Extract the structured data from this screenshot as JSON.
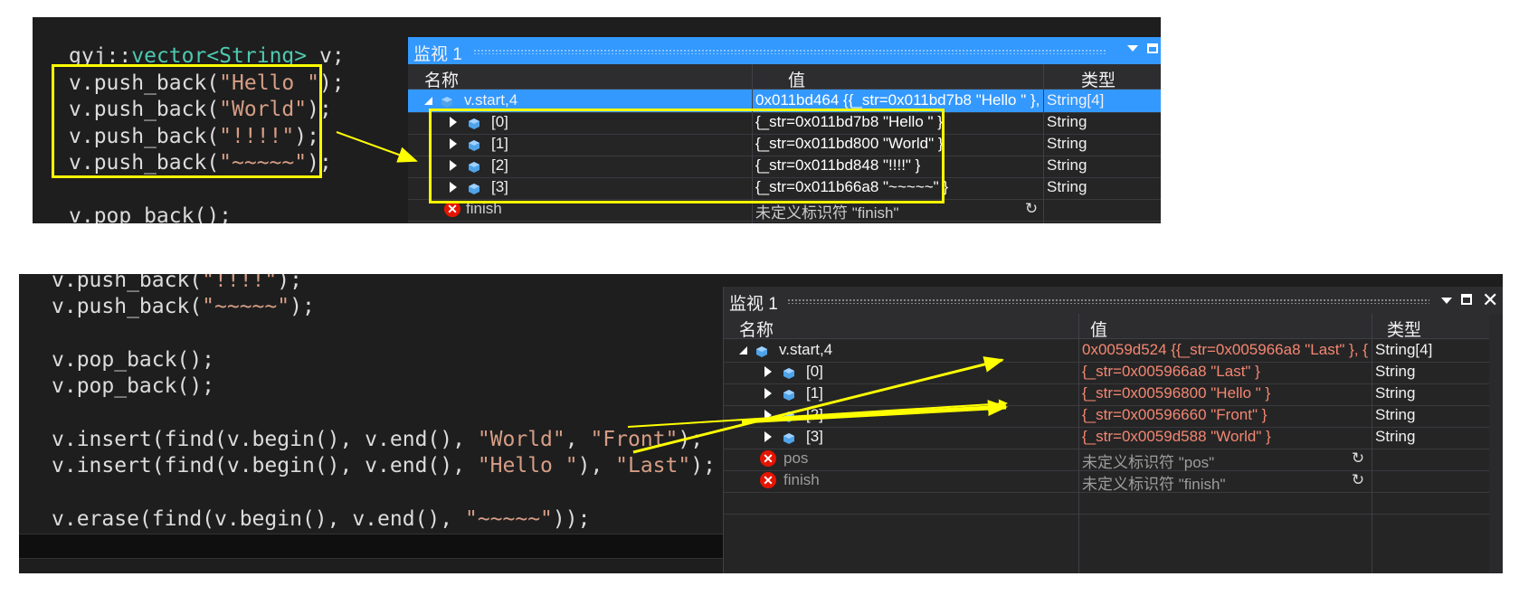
{
  "top": {
    "code_lines": [
      {
        "parts": [
          [
            "gyj::",
            "ns"
          ],
          [
            "vector<String>",
            "type"
          ],
          [
            " v;",
            "id"
          ]
        ]
      },
      {
        "parts": [
          [
            "v.push_back(",
            "id"
          ],
          [
            "\"Hello \"",
            "str"
          ],
          [
            ");",
            "id"
          ]
        ]
      },
      {
        "parts": [
          [
            "v.push_back(",
            "id"
          ],
          [
            "\"World\"",
            "str"
          ],
          [
            ");",
            "id"
          ]
        ]
      },
      {
        "parts": [
          [
            "v.push_back(",
            "id"
          ],
          [
            "\"!!!!\"",
            "str"
          ],
          [
            ");",
            "id"
          ]
        ]
      },
      {
        "parts": [
          [
            "v.push_back(",
            "id"
          ],
          [
            "\"~~~~~\"",
            "str"
          ],
          [
            ");",
            "id"
          ]
        ]
      },
      {
        "parts": [
          [
            "",
            "id"
          ]
        ]
      },
      {
        "parts": [
          [
            "v.pop_back();",
            "id"
          ]
        ]
      }
    ],
    "watch": {
      "title": "监视 1",
      "headers": {
        "name": "名称",
        "value": "值",
        "type": "类型"
      },
      "root": {
        "name": "v.start,4",
        "value": "0x011bd464 {{_str=0x011bd7b8 \"Hello \" },",
        "type": "String[4]"
      },
      "items": [
        {
          "name": "[0]",
          "value": "{_str=0x011bd7b8 \"Hello \" }",
          "type": "String"
        },
        {
          "name": "[1]",
          "value": "{_str=0x011bd800 \"World\" }",
          "type": "String"
        },
        {
          "name": "[2]",
          "value": "{_str=0x011bd848 \"!!!!\" }",
          "type": "String"
        },
        {
          "name": "[3]",
          "value": "{_str=0x011b66a8 \"~~~~~\" }",
          "type": "String"
        }
      ],
      "partial_row": {
        "name": "finish",
        "value": "未定义标识符 \"finish\""
      }
    }
  },
  "bottom": {
    "code_lines": [
      {
        "parts": [
          [
            "v.push_back(",
            "id"
          ],
          [
            "\"!!!!\"",
            "str"
          ],
          [
            ");",
            "id"
          ]
        ]
      },
      {
        "parts": [
          [
            "v.push_back(",
            "id"
          ],
          [
            "\"~~~~~\"",
            "str"
          ],
          [
            ");",
            "id"
          ]
        ]
      },
      {
        "parts": [
          [
            "",
            "id"
          ]
        ]
      },
      {
        "parts": [
          [
            "v.pop_back();",
            "id"
          ]
        ]
      },
      {
        "parts": [
          [
            "v.pop_back();",
            "id"
          ]
        ]
      },
      {
        "parts": [
          [
            "",
            "id"
          ]
        ]
      },
      {
        "parts": [
          [
            "v.insert(find(v.begin(), v.end(), ",
            "id"
          ],
          [
            "\"World\"",
            "str"
          ],
          [
            ", ",
            "id"
          ],
          [
            "\"Front\"",
            "str"
          ],
          [
            ");",
            "id"
          ]
        ]
      },
      {
        "parts": [
          [
            "v.insert(find(v.begin(), v.end(), ",
            "id"
          ],
          [
            "\"Hello \"",
            "str"
          ],
          [
            "), ",
            "id"
          ],
          [
            "\"Last\"",
            "str"
          ],
          [
            ");",
            "id"
          ]
        ]
      },
      {
        "parts": [
          [
            "",
            "id"
          ]
        ]
      },
      {
        "parts": [
          [
            "v.erase(find(v.begin(), v.end(), ",
            "id"
          ],
          [
            "\"~~~~~\"",
            "str"
          ],
          [
            "));",
            "id"
          ]
        ]
      }
    ],
    "watch": {
      "title": "监视 1",
      "headers": {
        "name": "名称",
        "value": "值",
        "type": "类型"
      },
      "root": {
        "name": "v.start,4",
        "value": "0x0059d524 {{_str=0x005966a8 \"Last\" }, {_s",
        "type": "String[4]"
      },
      "items": [
        {
          "name": "[0]",
          "value": "{_str=0x005966a8 \"Last\" }",
          "type": "String"
        },
        {
          "name": "[1]",
          "value": "{_str=0x00596800 \"Hello \" }",
          "type": "String"
        },
        {
          "name": "[2]",
          "value": "{_str=0x00596660 \"Front\" }",
          "type": "String"
        },
        {
          "name": "[3]",
          "value": "{_str=0x0059d588 \"World\" }",
          "type": "String"
        }
      ],
      "errors": [
        {
          "name": "pos",
          "value": "未定义标识符 \"pos\""
        },
        {
          "name": "finish",
          "value": "未定义标识符 \"finish\""
        }
      ]
    }
  },
  "colors": {
    "highlight": "#ffff00",
    "selection": "#3399ff",
    "changed_value": "#f48771",
    "error": "#e51400"
  },
  "icons": [
    "pin-icon",
    "maximize-icon",
    "close-icon",
    "expand-triangle-icon",
    "collapse-triangle-icon",
    "variable-cube-icon",
    "error-icon",
    "refresh-icon"
  ]
}
